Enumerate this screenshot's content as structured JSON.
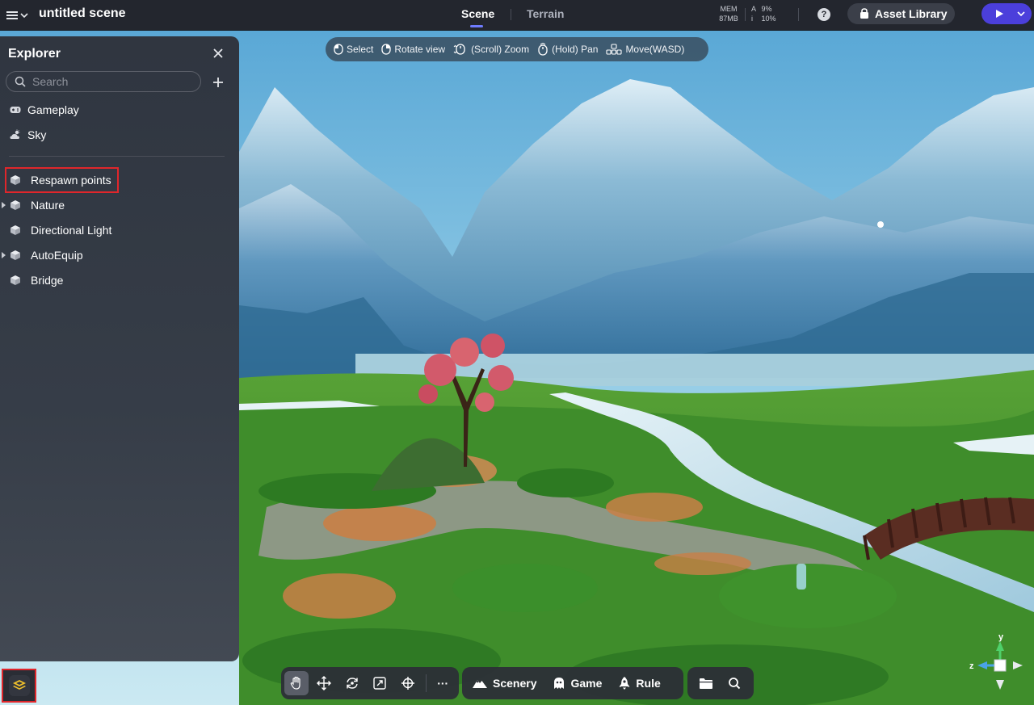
{
  "topbar": {
    "scene_title": "untitled scene",
    "tabs": [
      {
        "label": "Scene",
        "active": true
      },
      {
        "label": "Terrain",
        "active": false
      }
    ],
    "mem_label": "MEM",
    "mem_value": "87MB",
    "stat_a_label": "A",
    "stat_a_value": "9%",
    "stat_i_label": "i",
    "stat_i_value": "10%",
    "help_label": "?",
    "asset_library_label": "Asset Library",
    "accent_color": "#4b3fdb"
  },
  "controls_hint": [
    {
      "icon": "mouse-left-icon",
      "label": "Select"
    },
    {
      "icon": "mouse-right-icon",
      "label": "Rotate view"
    },
    {
      "icon": "mouse-scroll-icon",
      "label": "(Scroll) Zoom"
    },
    {
      "icon": "mouse-middle-icon",
      "label": "(Hold) Pan"
    },
    {
      "icon": "wasd-keys-icon",
      "label": "Move(WASD)"
    }
  ],
  "explorer": {
    "title": "Explorer",
    "search_placeholder": "Search",
    "top_items": [
      {
        "label": "Gameplay",
        "icon": "gamepad-icon"
      },
      {
        "label": "Sky",
        "icon": "sky-weather-icon"
      }
    ],
    "items": [
      {
        "label": "Respawn points",
        "expandable": false,
        "highlighted": true
      },
      {
        "label": "Nature",
        "expandable": true
      },
      {
        "label": "Directional Light",
        "expandable": false
      },
      {
        "label": "AutoEquip",
        "expandable": true
      },
      {
        "label": "Bridge",
        "expandable": false
      }
    ],
    "highlight_color": "#e0262b"
  },
  "toolbar": {
    "tools": [
      {
        "name": "hand-tool",
        "icon": "hand-icon",
        "active": true
      },
      {
        "name": "move-tool",
        "icon": "move-arrows-icon",
        "active": false
      },
      {
        "name": "rotate-tool",
        "icon": "rotate-icon",
        "active": false
      },
      {
        "name": "scale-tool",
        "icon": "scale-icon",
        "active": false
      },
      {
        "name": "transform-tool",
        "icon": "transform-icon",
        "active": false
      }
    ],
    "more_label": "···",
    "modes": [
      {
        "label": "Scenery",
        "icon": "mountain-icon"
      },
      {
        "label": "Game",
        "icon": "ghost-icon"
      },
      {
        "label": "Rule",
        "icon": "rocket-icon"
      }
    ]
  },
  "gizmo": {
    "y_label": "y",
    "z_label": "z"
  }
}
